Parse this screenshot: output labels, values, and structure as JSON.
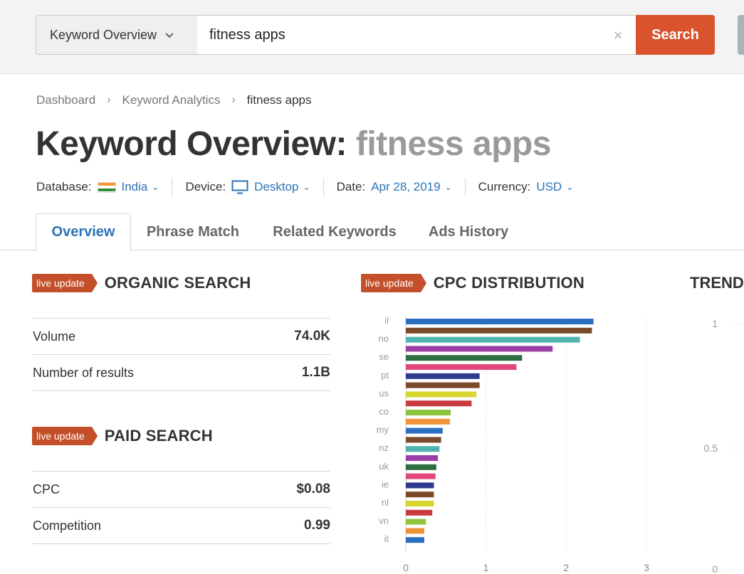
{
  "topbar": {
    "tool_select": "Keyword Overview",
    "search_value": "fitness apps",
    "search_button": "Search"
  },
  "breadcrumb": [
    "Dashboard",
    "Keyword Analytics",
    "fitness apps"
  ],
  "title": {
    "prefix": "Keyword Overview:",
    "keyword": "fitness apps"
  },
  "filters": {
    "database_label": "Database:",
    "database_value": "India",
    "device_label": "Device:",
    "device_value": "Desktop",
    "date_label": "Date:",
    "date_value": "Apr 28, 2019",
    "currency_label": "Currency:",
    "currency_value": "USD"
  },
  "tabs": [
    "Overview",
    "Phrase Match",
    "Related Keywords",
    "Ads History"
  ],
  "organic": {
    "badge": "live update",
    "title": "ORGANIC SEARCH",
    "rows": [
      {
        "label": "Volume",
        "value": "74.0K"
      },
      {
        "label": "Number of results",
        "value": "1.1B"
      }
    ]
  },
  "paid": {
    "badge": "live update",
    "title": "PAID SEARCH",
    "rows": [
      {
        "label": "CPC",
        "value": "$0.08"
      },
      {
        "label": "Competition",
        "value": "0.99"
      }
    ]
  },
  "cpc": {
    "badge": "live update",
    "title": "CPC DISTRIBUTION"
  },
  "trend": {
    "title": "TREND",
    "y_ticks": [
      "1",
      "0.5",
      "0"
    ]
  },
  "colors": {
    "accent_orange": "#d9532c",
    "link_blue": "#2a73b8"
  },
  "chart_data": {
    "type": "bar",
    "orientation": "horizontal",
    "categories": [
      "il",
      "",
      "no",
      "",
      "se",
      "",
      "pt",
      "",
      "us",
      "",
      "co",
      "",
      "my",
      "",
      "nz",
      "",
      "uk",
      "",
      "ie",
      "",
      "nl",
      "",
      "vn",
      "",
      "it",
      ""
    ],
    "values": [
      2.34,
      2.32,
      2.17,
      1.83,
      1.45,
      1.38,
      0.92,
      0.92,
      0.88,
      0.82,
      0.56,
      0.55,
      0.46,
      0.44,
      0.42,
      0.4,
      0.38,
      0.37,
      0.35,
      0.35,
      0.35,
      0.33,
      0.25,
      0.23,
      0.23
    ],
    "colors": [
      "#2a6fc0",
      "#7a4a2a",
      "#4fb3b0",
      "#9c3ea6",
      "#2f6e3e",
      "#e0487c",
      "#2e3a8c",
      "#7a4a2a",
      "#d6d62e",
      "#c9393f",
      "#8cc63f",
      "#f0923a",
      "#2a6fc0",
      "#7a4a2a",
      "#4fb3b0",
      "#9c3ea6",
      "#2f6e3e",
      "#e0487c",
      "#2e3a8c",
      "#7a4a2a",
      "#d6d62e",
      "#c9393f",
      "#8cc63f",
      "#f0923a",
      "#2a6fc0"
    ],
    "x_ticks": [
      "0",
      "1",
      "2",
      "3"
    ],
    "xlim": [
      0,
      3
    ],
    "grid": true
  }
}
